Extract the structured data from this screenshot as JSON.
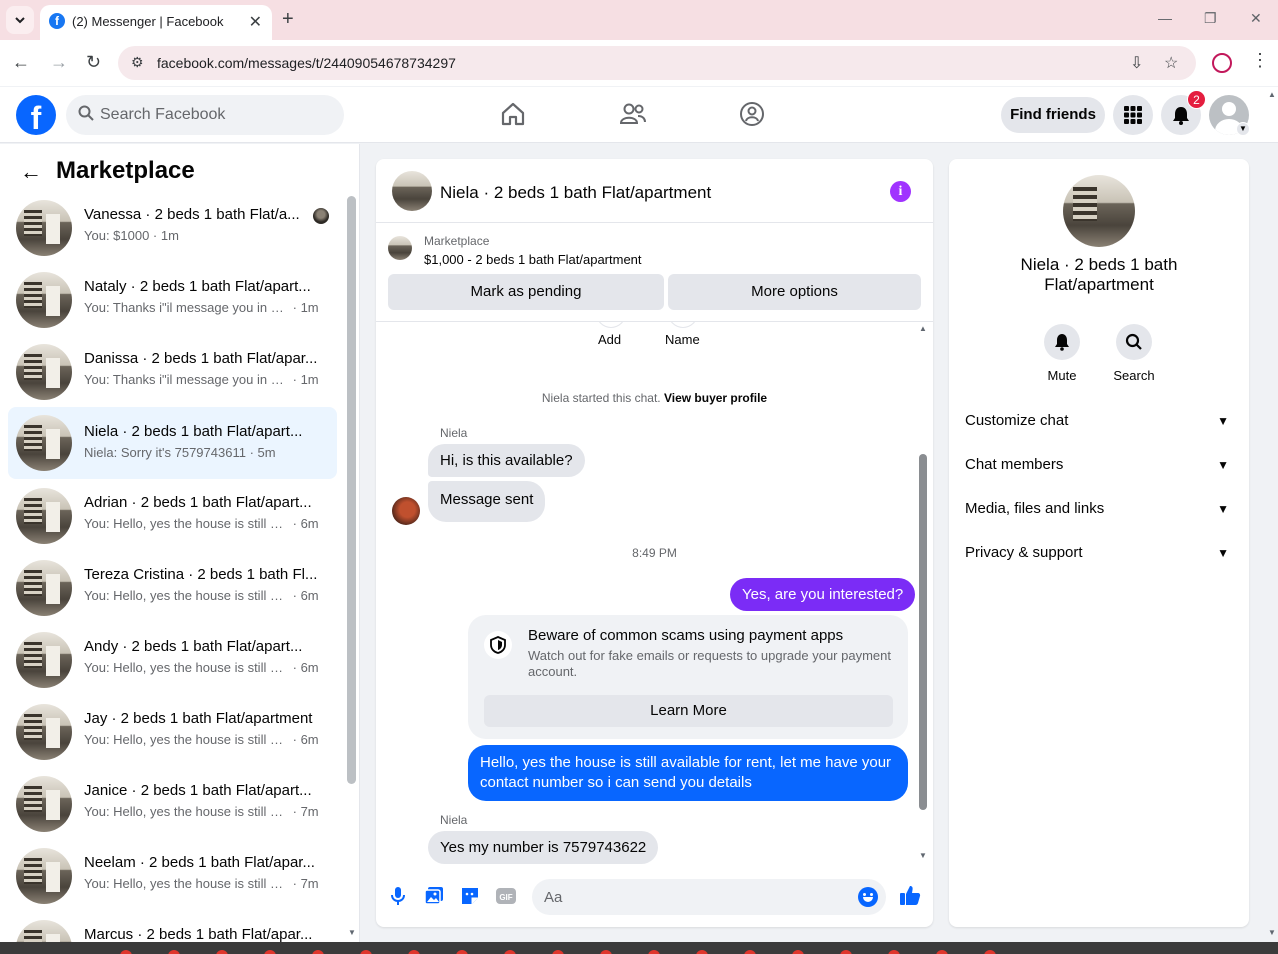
{
  "browser": {
    "tab_title": "(2) Messenger | Facebook",
    "url": "facebook.com/messages/t/24409054678734297"
  },
  "header": {
    "search_placeholder": "Search Facebook",
    "find_friends": "Find friends",
    "notification_count": "2"
  },
  "left": {
    "title": "Marketplace",
    "conversations": [
      {
        "name": "Vanessa · 2 beds 1 bath Flat/a...",
        "snippet": "You: $1000",
        "time": "1m",
        "active": false
      },
      {
        "name": "Nataly · 2 beds 1 bath Flat/apart...",
        "snippet": "You: Thanks i\"il message you in a ...",
        "time": "1m",
        "active": false
      },
      {
        "name": "Danissa · 2 beds 1 bath Flat/apar...",
        "snippet": "You: Thanks i\"il message you in a ...",
        "time": "1m",
        "active": false
      },
      {
        "name": "Niela · 2 beds 1 bath Flat/apart...",
        "snippet": "Niela: Sorry it's 7579743611",
        "time": "5m",
        "active": true
      },
      {
        "name": "Adrian · 2 beds 1 bath Flat/apart...",
        "snippet": "You: Hello, yes the house is still av...",
        "time": "6m",
        "active": false
      },
      {
        "name": "Tereza Cristina · 2 beds 1 bath Fl...",
        "snippet": "You: Hello, yes the house is still av...",
        "time": "6m",
        "active": false
      },
      {
        "name": "Andy · 2 beds 1 bath Flat/apart...",
        "snippet": "You: Hello, yes the house is still av...",
        "time": "6m",
        "active": false
      },
      {
        "name": "Jay · 2 beds 1 bath Flat/apartment",
        "snippet": "You: Hello, yes the house is still av...",
        "time": "6m",
        "active": false
      },
      {
        "name": "Janice · 2 beds 1 bath Flat/apart...",
        "snippet": "You: Hello, yes the house is still av...",
        "time": "7m",
        "active": false
      },
      {
        "name": "Neelam · 2 beds 1 bath Flat/apar...",
        "snippet": "You: Hello, yes the house is still av...",
        "time": "7m",
        "active": false
      },
      {
        "name": "Marcus · 2 beds 1 bath Flat/apar...",
        "snippet": "",
        "time": "",
        "active": false
      }
    ]
  },
  "chat": {
    "title": "Niela · 2 beds 1 bath Flat/apartment",
    "marketplace_label": "Marketplace",
    "listing": "$1,000 - 2 beds 1 bath Flat/apartment",
    "mark_pending": "Mark as pending",
    "more_options": "More options",
    "stub_add": "Add",
    "stub_name": "Name",
    "system_text": "Niela started this chat. ",
    "view_profile": "View buyer profile",
    "sender_name": "Niela",
    "msg1": "Hi, is this available?",
    "msg2": "Message sent",
    "timestamp": "8:49 PM",
    "out1": "Yes, are you interested?",
    "scam_title": "Beware of common scams using payment apps",
    "scam_body": "Watch out for fake emails or requests to upgrade your payment account.",
    "learn_more": "Learn More",
    "out2": "Hello, yes the house is still available for rent, let me have your contact number so i can send you details",
    "msg3": "Yes my number is 7579743622",
    "composer_placeholder": "Aa"
  },
  "right": {
    "name": "Niela · 2 beds 1 bath Flat/apartment",
    "mute": "Mute",
    "search": "Search",
    "rows": [
      "Customize chat",
      "Chat members",
      "Media, files and links",
      "Privacy & support"
    ]
  },
  "colors": {
    "accent_blue": "#0866ff",
    "purple_bubble": "#7b2cf6",
    "active_row": "#ebf5ff"
  }
}
